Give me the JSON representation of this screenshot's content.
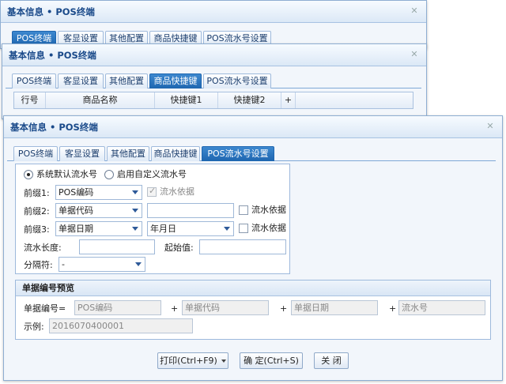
{
  "colors": {
    "title_text": "#1a4a8a",
    "active_tab": "#1e66b0",
    "border": "#8eaed2"
  },
  "window1": {
    "title": "基本信息 • POS终端",
    "tabs": [
      "POS终端",
      "客显设置",
      "其他配置",
      "商品快捷键",
      "POS流水号设置"
    ],
    "active_tab": "POS终端"
  },
  "window2": {
    "title": "基本信息 • POS终端",
    "tabs": [
      "POS终端",
      "客显设置",
      "其他配置",
      "商品快捷键",
      "POS流水号设置"
    ],
    "active_tab": "商品快捷键",
    "grid_headers": [
      "行号",
      "商品名称",
      "快捷键1",
      "快捷键2",
      "+"
    ]
  },
  "window3": {
    "title": "基本信息 • POS终端",
    "tabs": [
      "POS终端",
      "客显设置",
      "其他配置",
      "商品快捷键",
      "POS流水号设置"
    ],
    "active_tab": "POS流水号设置",
    "radio_default": "系统默认流水号",
    "radio_custom": "启用自定义流水号",
    "prefix1_label": "前缀1:",
    "prefix1_value": "POS编码",
    "prefix1_check": "流水依据",
    "prefix2_label": "前缀2:",
    "prefix2_value": "单据代码",
    "prefix2_check": "流水依据",
    "prefix3_label": "前缀3:",
    "prefix3_value": "单据日期",
    "prefix3_format": "年月日",
    "prefix3_check": "流水依据",
    "length_label": "流水长度:",
    "start_label": "起始值:",
    "separator_label": "分隔符:",
    "separator_value": "-",
    "preview": {
      "title": "单据编号预览",
      "number_label": "单据编号=",
      "parts": [
        "POS编码",
        "单据代码",
        "单据日期",
        "流水号"
      ],
      "plus": "+",
      "example_label": "示例:",
      "example_value": "2016070400001"
    },
    "buttons": {
      "print": "打印(Ctrl+F9)",
      "confirm": "确 定(Ctrl+S)",
      "close": "关 闭"
    }
  },
  "icons": {
    "close": "close-icon",
    "dropdown": "chevron-down-icon"
  }
}
